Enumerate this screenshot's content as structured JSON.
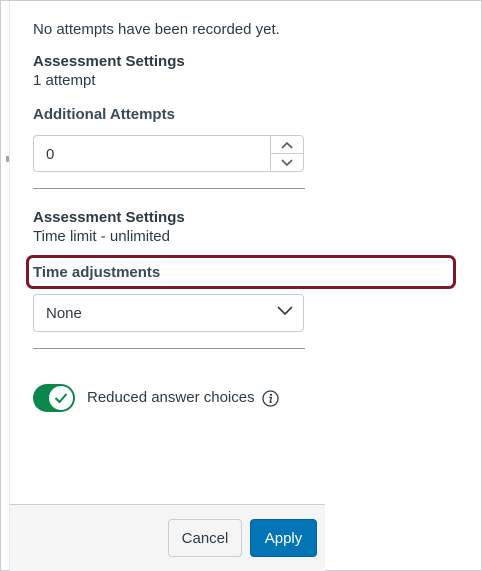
{
  "attempts": {
    "status_text": "No attempts have been recorded yet.",
    "assessment_heading": "Assessment Settings",
    "assessment_value": "1 attempt",
    "additional_label": "Additional Attempts",
    "additional_value": "0"
  },
  "time": {
    "assessment_heading": "Assessment Settings",
    "assessment_value": "Time limit - unlimited",
    "adjustments_label": "Time adjustments",
    "adjustments_selected": "None"
  },
  "accommodations": {
    "reduced_choices_label": "Reduced answer choices",
    "reduced_choices_enabled": true
  },
  "footer": {
    "cancel_label": "Cancel",
    "apply_label": "Apply"
  },
  "colors": {
    "highlight": "#7a1b25",
    "toggle_on": "#0b874b",
    "apply_button": "#0374b5"
  },
  "icons": {
    "stepper_up": "chevron-up-icon",
    "stepper_down": "chevron-down-icon",
    "select_arrow": "chevron-down-icon",
    "toggle": "checkmark-icon",
    "info": "info-icon"
  }
}
